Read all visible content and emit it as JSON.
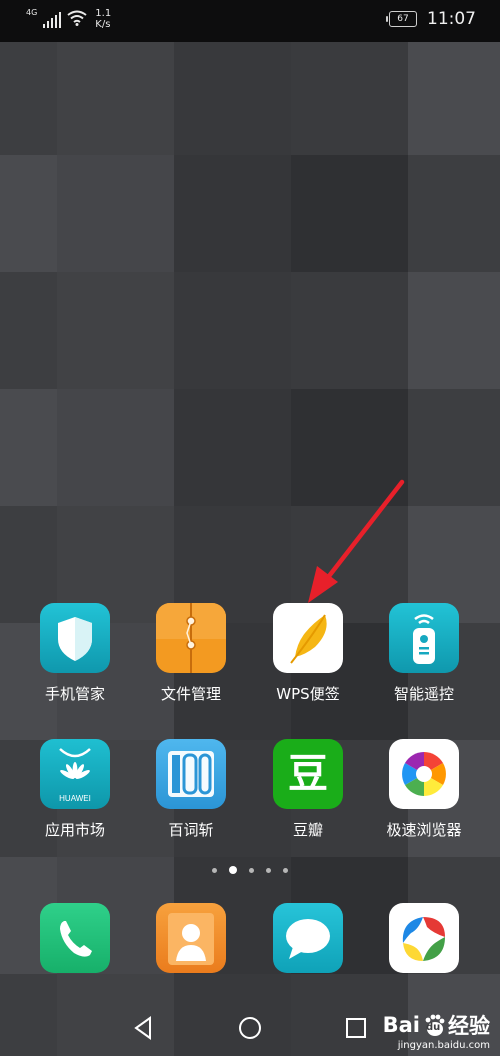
{
  "status_bar": {
    "network": "4G",
    "speed_value": "1.1",
    "speed_unit": "K/s",
    "battery": "67",
    "time": "11:07"
  },
  "apps_row1": [
    {
      "label": "手机管家",
      "icon": "shield-icon",
      "color": "#16a8c0"
    },
    {
      "label": "文件管理",
      "icon": "folder-icon",
      "color": "#f39a21"
    },
    {
      "label": "WPS便签",
      "icon": "feather-icon",
      "color": "#ffffff"
    },
    {
      "label": "智能遥控",
      "icon": "remote-icon",
      "color": "#16a8c0"
    }
  ],
  "apps_row2": [
    {
      "label": "应用市场",
      "icon": "huawei-appgallery-icon",
      "color": "#12a5b8",
      "brand": "HUAWEI"
    },
    {
      "label": "百词斩",
      "icon": "baicizhan-icon",
      "color": "#3aa7e0",
      "glyph": "100"
    },
    {
      "label": "豆瓣",
      "icon": "douban-icon",
      "color": "#1aad19",
      "glyph": "豆"
    },
    {
      "label": "极速浏览器",
      "icon": "browser-pinwheel-icon",
      "color": "#ffffff"
    }
  ],
  "dock": [
    {
      "icon": "phone-icon",
      "color": "#1fbf79"
    },
    {
      "icon": "contacts-icon",
      "color": "#f08a2c"
    },
    {
      "icon": "messages-icon",
      "color": "#1ab2c9"
    },
    {
      "icon": "browser-icon",
      "color": "#ffffff"
    }
  ],
  "page_indicator": {
    "pages": 5,
    "current": 2
  },
  "navigation": [
    "back-icon",
    "home-icon",
    "recents-icon"
  ],
  "annotation_arrow_color": "#e8202a",
  "watermark": {
    "brand_left": "Bai",
    "brand_paw": "du",
    "brand_right": "经验",
    "sub": "jingyan.baidu.com"
  }
}
